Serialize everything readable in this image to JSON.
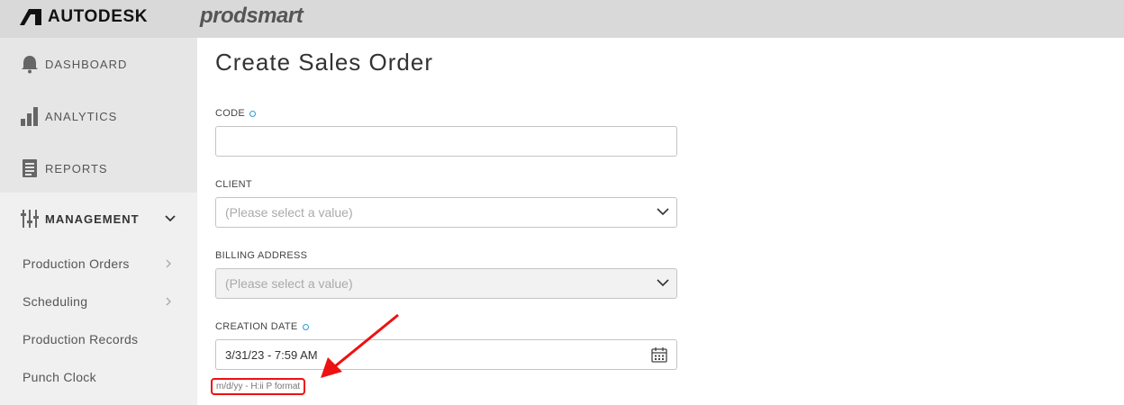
{
  "header": {
    "brand": "AUTODESK",
    "product": "prodsmart"
  },
  "sidebar": {
    "items": [
      {
        "label": "DASHBOARD",
        "icon": "bell-icon"
      },
      {
        "label": "ANALYTICS",
        "icon": "bar-chart-icon"
      },
      {
        "label": "REPORTS",
        "icon": "document-icon"
      },
      {
        "label": "MANAGEMENT",
        "icon": "sliders-icon",
        "expanded": true
      }
    ],
    "subitems": [
      {
        "label": "Production Orders",
        "has_arrow": true
      },
      {
        "label": "Scheduling",
        "has_arrow": true
      },
      {
        "label": "Production Records",
        "has_arrow": false
      },
      {
        "label": "Punch Clock",
        "has_arrow": false
      }
    ]
  },
  "main": {
    "title": "Create Sales Order",
    "fields": {
      "code": {
        "label": "CODE",
        "required": true,
        "value": ""
      },
      "client": {
        "label": "CLIENT",
        "placeholder": "(Please select a value)"
      },
      "billing": {
        "label": "BILLING ADDRESS",
        "placeholder": "(Please select a value)",
        "disabled": true
      },
      "creation_date": {
        "label": "CREATION DATE",
        "required": true,
        "value": "3/31/23 - 7:59 AM",
        "hint": "m/d/yy - H:ii P format"
      }
    }
  },
  "colors": {
    "required_dot": "#2b9bd6",
    "highlight": "#e11111",
    "topbar": "#d9d9d9"
  }
}
